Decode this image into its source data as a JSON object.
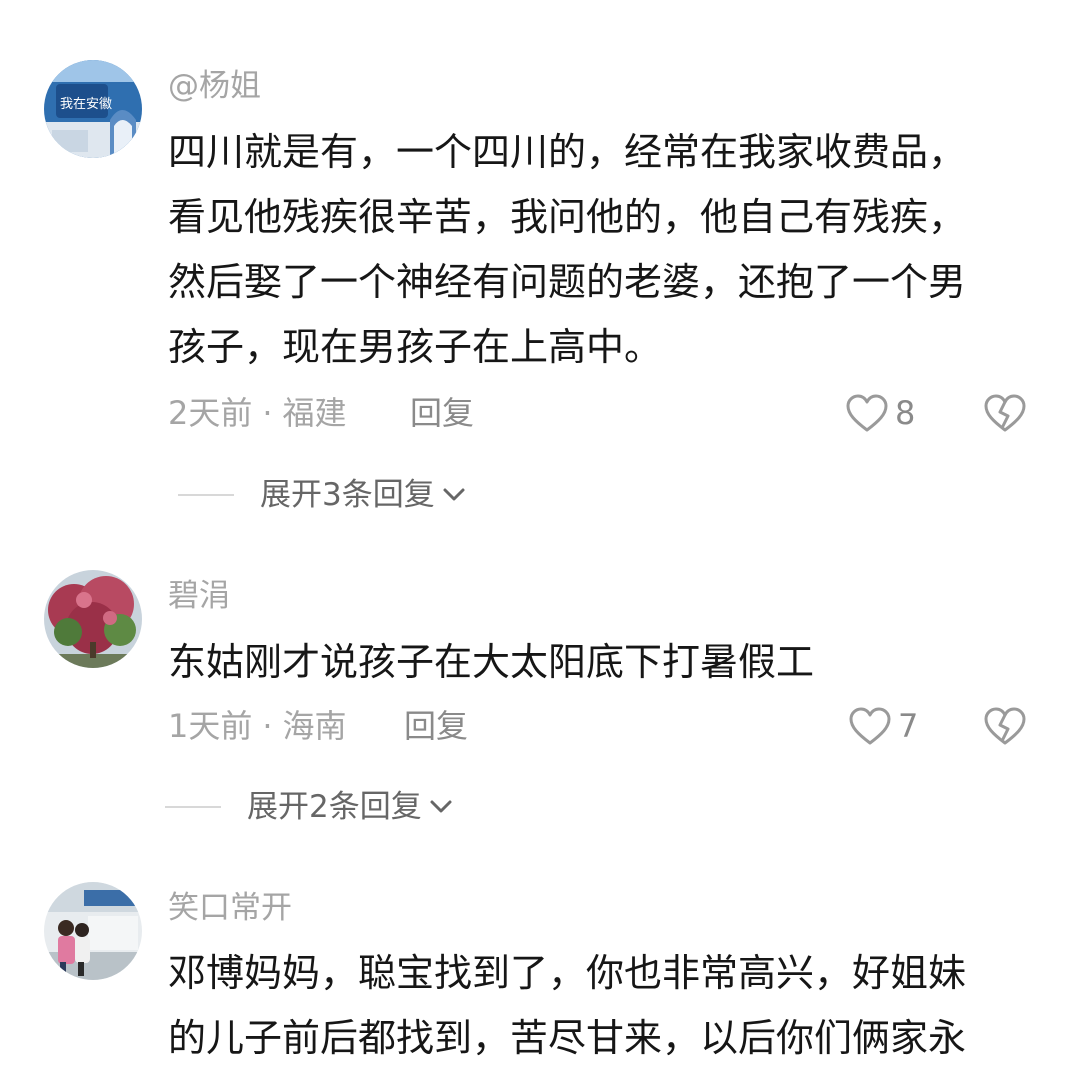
{
  "comments": [
    {
      "username": "@杨姐",
      "avatar_text": "我在安徽",
      "lines": [
        "四川就是有，一个四川的，经常在我家收费品，",
        "看见他残疾很辛苦，我问他的，他自己有残疾，",
        "然后娶了一个神经有问题的老婆，还抱了一个男",
        "孩子，现在男孩子在上高中。"
      ],
      "time": "2天前",
      "dot": "·",
      "location": "福建",
      "reply": "回复",
      "likes": "8",
      "expand": "展开3条回复"
    },
    {
      "username": "碧涓",
      "lines": [
        "东姑刚才说孩子在大太阳底下打暑假工"
      ],
      "time": "1天前",
      "dot": "·",
      "location": "海南",
      "reply": "回复",
      "likes": "7",
      "expand": "展开2条回复"
    },
    {
      "username": "笑口常开",
      "lines": [
        "邓博妈妈，聪宝找到了，你也非常高兴，好姐妹",
        "的儿子前后都找到，苦尽甘来，以后你们俩家永"
      ]
    }
  ]
}
